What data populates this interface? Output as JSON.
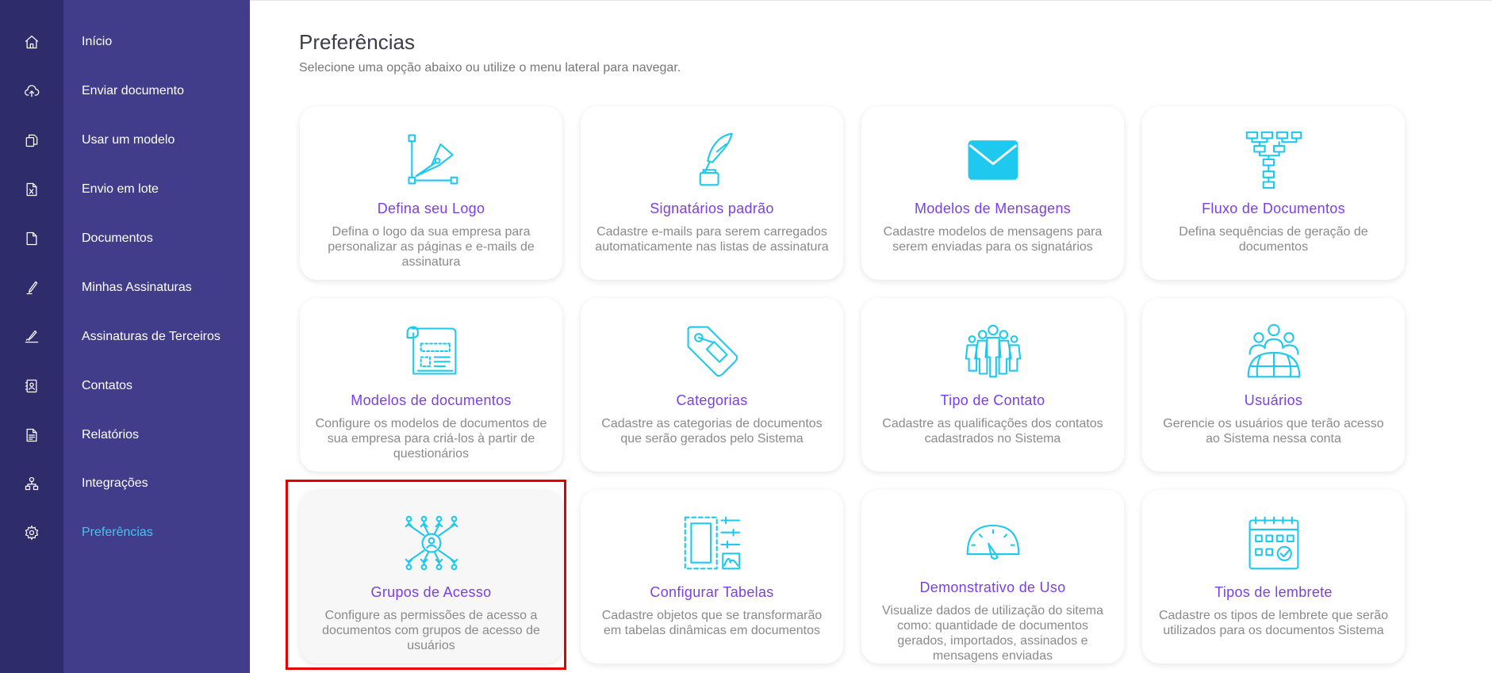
{
  "sidebar": {
    "items": [
      {
        "label": "Início",
        "icon": "home-icon"
      },
      {
        "label": "Enviar documento",
        "icon": "cloud-upload-icon"
      },
      {
        "label": "Usar um modelo",
        "icon": "copy-icon"
      },
      {
        "label": "Envio em lote",
        "icon": "excel-file-icon"
      },
      {
        "label": "Documentos",
        "icon": "document-icon"
      },
      {
        "label": "Minhas Assinaturas",
        "icon": "pen-icon"
      },
      {
        "label": "Assinaturas de Terceiros",
        "icon": "signature-icon"
      },
      {
        "label": "Contatos",
        "icon": "contacts-icon"
      },
      {
        "label": "Relatórios",
        "icon": "report-icon"
      },
      {
        "label": "Integrações",
        "icon": "integrations-icon"
      },
      {
        "label": "Preferências",
        "icon": "gear-icon",
        "active": true
      }
    ]
  },
  "page": {
    "title": "Preferências",
    "subtitle": "Selecione uma opção abaixo ou utilize o menu lateral para navegar."
  },
  "cards": [
    {
      "title": "Defina seu Logo",
      "desc": "Defina o logo da sua empresa para personalizar as páginas e e-mails de assinatura",
      "icon": "pen-tool-icon"
    },
    {
      "title": "Signatários padrão",
      "desc": "Cadastre e-mails para serem carregados automaticamente nas listas de assinatura",
      "icon": "quill-inkwell-icon"
    },
    {
      "title": "Modelos de Mensagens",
      "desc": "Cadastre modelos de mensagens para serem enviadas para os signatários",
      "icon": "envelope-icon"
    },
    {
      "title": "Fluxo de Documentos",
      "desc": "Defina sequências de geração de documentos",
      "icon": "flowchart-icon"
    },
    {
      "title": "Modelos de documentos",
      "desc": "Configure os modelos de documentos de sua empresa para criá-los à partir de questionários",
      "icon": "template-scroll-icon"
    },
    {
      "title": "Categorias",
      "desc": "Cadastre as categorias de documentos que serão gerados pelo Sistema",
      "icon": "tag-icon"
    },
    {
      "title": "Tipo de Contato",
      "desc": "Cadastre as qualificações dos contatos cadastrados no Sistema",
      "icon": "people-group-icon"
    },
    {
      "title": "Usuários",
      "desc": "Gerencie os usuários que terão acesso ao Sistema nessa conta",
      "icon": "users-globe-icon"
    },
    {
      "title": "Grupos de Acesso",
      "desc": "Configure as permissões de acesso a documentos com grupos de acesso de usuários",
      "icon": "access-network-icon",
      "selected": true
    },
    {
      "title": "Configurar Tabelas",
      "desc": "Cadastre objetos que se transformarão em tabelas dinâmicas em documentos",
      "icon": "table-config-icon"
    },
    {
      "title": "Demonstrativo de Uso",
      "desc": "Visualize dados de utilização do sitema como: quantidade de documentos gerados, importados, assinados e mensagens enviadas",
      "icon": "gauge-icon"
    },
    {
      "title": "Tipos de lembrete",
      "desc": "Cadastre os tipos de lembrete que serão utilizados para os documentos Sistema",
      "icon": "calendar-check-icon"
    }
  ],
  "colors": {
    "icon_rail": "#2f2c6b",
    "menu_bg": "#413d8a",
    "active_item": "#3ec7ef",
    "card_title": "#7a3fe8",
    "card_icon": "#1ec8ef",
    "highlight_border": "#e60000"
  }
}
